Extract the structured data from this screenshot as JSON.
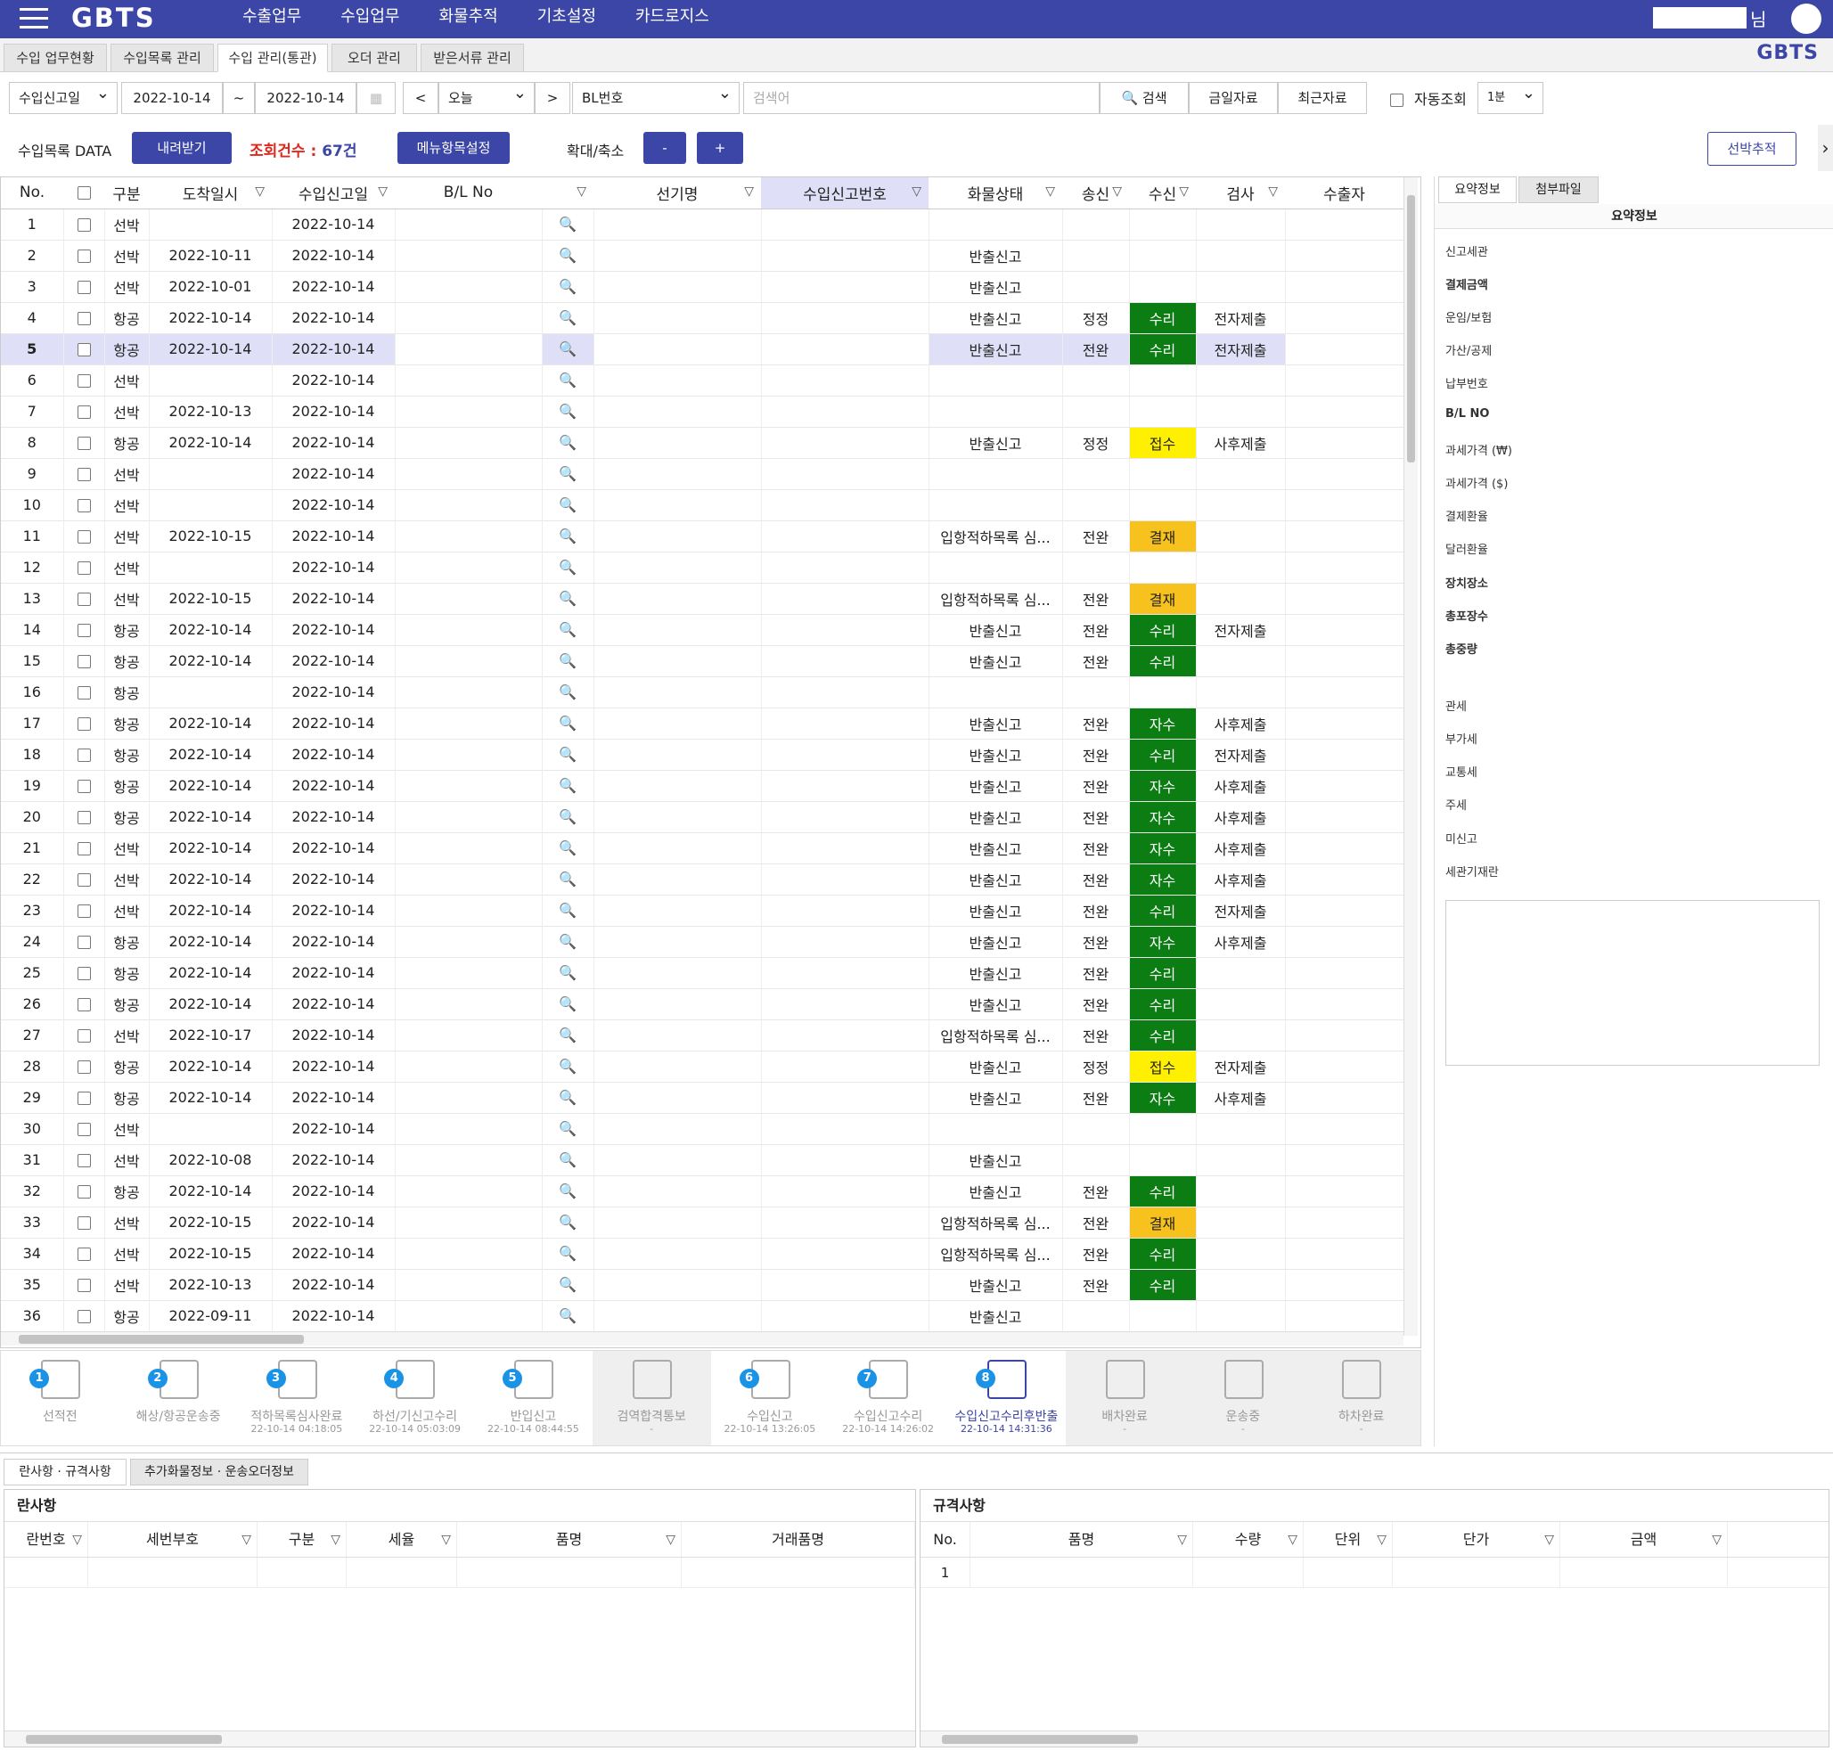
{
  "header": {
    "logo": "GBTS",
    "nav": [
      "수출업무",
      "수입업무",
      "화물추적",
      "기초설정",
      "카드로지스"
    ],
    "user_suffix": "님"
  },
  "tabs": [
    {
      "label": "수입 업무현황",
      "active": false
    },
    {
      "label": "수입목록 관리",
      "active": false
    },
    {
      "label": "수입 관리(통관)",
      "active": true
    },
    {
      "label": "오더 관리",
      "active": false
    },
    {
      "label": "받은서류 관리",
      "active": false
    }
  ],
  "brand_right": "GBTS",
  "filter": {
    "date_type": "수입신고일",
    "date_from": "2022-10-14",
    "tilde": "~",
    "date_to": "2022-10-14",
    "prev": "<",
    "period": "오늘",
    "next": ">",
    "search_type": "BL번호",
    "search_placeholder": "검색어",
    "search_button": "검색",
    "today_button": "금일자료",
    "recent_button": "최근자료",
    "auto_label": "자동조회",
    "auto_interval": "1분"
  },
  "actions": {
    "list_label": "수입목록 DATA",
    "download": "내려받기",
    "count_label": "조회건수 :",
    "count_value": "67건",
    "menu_setting": "메뉴항목설정",
    "zoom_label": "확대/축소",
    "zoom_out": "-",
    "zoom_in": "+",
    "vessel_track": "선박추적"
  },
  "grid": {
    "columns": [
      "No.",
      "",
      "구분",
      "도착일시",
      "수입신고일",
      "B/L No",
      "",
      "선기명",
      "수입신고번호",
      "화물상태",
      "송신",
      "수신",
      "검사",
      "수출자"
    ],
    "rows": [
      {
        "no": "1",
        "type": "선박",
        "arrive": "",
        "decl": "2022-10-14",
        "status": "",
        "send": "",
        "recv": "",
        "recvc": "",
        "insp": ""
      },
      {
        "no": "2",
        "type": "선박",
        "arrive": "2022-10-11",
        "decl": "2022-10-14",
        "status": "반출신고",
        "send": "",
        "recv": "",
        "recvc": "",
        "insp": ""
      },
      {
        "no": "3",
        "type": "선박",
        "arrive": "2022-10-01",
        "decl": "2022-10-14",
        "status": "반출신고",
        "send": "",
        "recv": "",
        "recvc": "",
        "insp": ""
      },
      {
        "no": "4",
        "type": "항공",
        "arrive": "2022-10-14",
        "decl": "2022-10-14",
        "status": "반출신고",
        "send": "정정",
        "recv": "수리",
        "recvc": "green",
        "insp": "전자제출"
      },
      {
        "no": "5",
        "type": "항공",
        "arrive": "2022-10-14",
        "decl": "2022-10-14",
        "status": "반출신고",
        "send": "전완",
        "recv": "수리",
        "recvc": "green",
        "insp": "전자제출",
        "selected": true
      },
      {
        "no": "6",
        "type": "선박",
        "arrive": "",
        "decl": "2022-10-14",
        "status": "",
        "send": "",
        "recv": "",
        "recvc": "",
        "insp": ""
      },
      {
        "no": "7",
        "type": "선박",
        "arrive": "2022-10-13",
        "decl": "2022-10-14",
        "status": "",
        "send": "",
        "recv": "",
        "recvc": "",
        "insp": ""
      },
      {
        "no": "8",
        "type": "항공",
        "arrive": "2022-10-14",
        "decl": "2022-10-14",
        "status": "반출신고",
        "send": "정정",
        "recv": "접수",
        "recvc": "yellow",
        "insp": "사후제출"
      },
      {
        "no": "9",
        "type": "선박",
        "arrive": "",
        "decl": "2022-10-14",
        "status": "",
        "send": "",
        "recv": "",
        "recvc": "",
        "insp": ""
      },
      {
        "no": "10",
        "type": "선박",
        "arrive": "",
        "decl": "2022-10-14",
        "status": "",
        "send": "",
        "recv": "",
        "recvc": "",
        "insp": ""
      },
      {
        "no": "11",
        "type": "선박",
        "arrive": "2022-10-15",
        "decl": "2022-10-14",
        "status": "입항적하목록 심...",
        "send": "전완",
        "recv": "결재",
        "recvc": "orange",
        "insp": ""
      },
      {
        "no": "12",
        "type": "선박",
        "arrive": "",
        "decl": "2022-10-14",
        "status": "",
        "send": "",
        "recv": "",
        "recvc": "",
        "insp": ""
      },
      {
        "no": "13",
        "type": "선박",
        "arrive": "2022-10-15",
        "decl": "2022-10-14",
        "status": "입항적하목록 심...",
        "send": "전완",
        "recv": "결재",
        "recvc": "orange",
        "insp": ""
      },
      {
        "no": "14",
        "type": "항공",
        "arrive": "2022-10-14",
        "decl": "2022-10-14",
        "status": "반출신고",
        "send": "전완",
        "recv": "수리",
        "recvc": "green",
        "insp": "전자제출"
      },
      {
        "no": "15",
        "type": "항공",
        "arrive": "2022-10-14",
        "decl": "2022-10-14",
        "status": "반출신고",
        "send": "전완",
        "recv": "수리",
        "recvc": "green",
        "insp": ""
      },
      {
        "no": "16",
        "type": "항공",
        "arrive": "",
        "decl": "2022-10-14",
        "status": "",
        "send": "",
        "recv": "",
        "recvc": "",
        "insp": ""
      },
      {
        "no": "17",
        "type": "항공",
        "arrive": "2022-10-14",
        "decl": "2022-10-14",
        "status": "반출신고",
        "send": "전완",
        "recv": "자수",
        "recvc": "green",
        "insp": "사후제출"
      },
      {
        "no": "18",
        "type": "항공",
        "arrive": "2022-10-14",
        "decl": "2022-10-14",
        "status": "반출신고",
        "send": "전완",
        "recv": "수리",
        "recvc": "green",
        "insp": "전자제출"
      },
      {
        "no": "19",
        "type": "항공",
        "arrive": "2022-10-14",
        "decl": "2022-10-14",
        "status": "반출신고",
        "send": "전완",
        "recv": "자수",
        "recvc": "green",
        "insp": "사후제출"
      },
      {
        "no": "20",
        "type": "항공",
        "arrive": "2022-10-14",
        "decl": "2022-10-14",
        "status": "반출신고",
        "send": "전완",
        "recv": "자수",
        "recvc": "green",
        "insp": "사후제출"
      },
      {
        "no": "21",
        "type": "선박",
        "arrive": "2022-10-14",
        "decl": "2022-10-14",
        "status": "반출신고",
        "send": "전완",
        "recv": "자수",
        "recvc": "green",
        "insp": "사후제출"
      },
      {
        "no": "22",
        "type": "선박",
        "arrive": "2022-10-14",
        "decl": "2022-10-14",
        "status": "반출신고",
        "send": "전완",
        "recv": "자수",
        "recvc": "green",
        "insp": "사후제출"
      },
      {
        "no": "23",
        "type": "선박",
        "arrive": "2022-10-14",
        "decl": "2022-10-14",
        "status": "반출신고",
        "send": "전완",
        "recv": "수리",
        "recvc": "green",
        "insp": "전자제출"
      },
      {
        "no": "24",
        "type": "항공",
        "arrive": "2022-10-14",
        "decl": "2022-10-14",
        "status": "반출신고",
        "send": "전완",
        "recv": "자수",
        "recvc": "green",
        "insp": "사후제출"
      },
      {
        "no": "25",
        "type": "항공",
        "arrive": "2022-10-14",
        "decl": "2022-10-14",
        "status": "반출신고",
        "send": "전완",
        "recv": "수리",
        "recvc": "green",
        "insp": ""
      },
      {
        "no": "26",
        "type": "항공",
        "arrive": "2022-10-14",
        "decl": "2022-10-14",
        "status": "반출신고",
        "send": "전완",
        "recv": "수리",
        "recvc": "green",
        "insp": ""
      },
      {
        "no": "27",
        "type": "선박",
        "arrive": "2022-10-17",
        "decl": "2022-10-14",
        "status": "입항적하목록 심...",
        "send": "전완",
        "recv": "수리",
        "recvc": "green",
        "insp": ""
      },
      {
        "no": "28",
        "type": "항공",
        "arrive": "2022-10-14",
        "decl": "2022-10-14",
        "status": "반출신고",
        "send": "정정",
        "recv": "접수",
        "recvc": "yellow",
        "insp": "전자제출"
      },
      {
        "no": "29",
        "type": "항공",
        "arrive": "2022-10-14",
        "decl": "2022-10-14",
        "status": "반출신고",
        "send": "전완",
        "recv": "자수",
        "recvc": "green",
        "insp": "사후제출"
      },
      {
        "no": "30",
        "type": "선박",
        "arrive": "",
        "decl": "2022-10-14",
        "status": "",
        "send": "",
        "recv": "",
        "recvc": "",
        "insp": ""
      },
      {
        "no": "31",
        "type": "선박",
        "arrive": "2022-10-08",
        "decl": "2022-10-14",
        "status": "반출신고",
        "send": "",
        "recv": "",
        "recvc": "",
        "insp": ""
      },
      {
        "no": "32",
        "type": "항공",
        "arrive": "2022-10-14",
        "decl": "2022-10-14",
        "status": "반출신고",
        "send": "전완",
        "recv": "수리",
        "recvc": "green",
        "insp": ""
      },
      {
        "no": "33",
        "type": "선박",
        "arrive": "2022-10-15",
        "decl": "2022-10-14",
        "status": "입항적하목록 심...",
        "send": "전완",
        "recv": "결재",
        "recvc": "orange",
        "insp": ""
      },
      {
        "no": "34",
        "type": "선박",
        "arrive": "2022-10-15",
        "decl": "2022-10-14",
        "status": "입항적하목록 심...",
        "send": "전완",
        "recv": "수리",
        "recvc": "green",
        "insp": ""
      },
      {
        "no": "35",
        "type": "선박",
        "arrive": "2022-10-13",
        "decl": "2022-10-14",
        "status": "반출신고",
        "send": "전완",
        "recv": "수리",
        "recvc": "green",
        "insp": ""
      },
      {
        "no": "36",
        "type": "항공",
        "arrive": "2022-09-11",
        "decl": "2022-10-14",
        "status": "반출신고",
        "send": "",
        "recv": "",
        "recvc": "",
        "insp": ""
      }
    ]
  },
  "steps": [
    {
      "num": "1",
      "name": "선적전",
      "time": "",
      "icon": "warehouse-icon",
      "dim": false,
      "current": false
    },
    {
      "num": "2",
      "name": "해상/항공운송중",
      "time": "",
      "icon": "ship-icon",
      "dim": false,
      "current": false
    },
    {
      "num": "3",
      "name": "적하목록심사완료",
      "time": "22-10-14 04:18:05",
      "icon": "document-check-icon",
      "dim": false,
      "current": false
    },
    {
      "num": "4",
      "name": "하선/기신고수리",
      "time": "22-10-14 05:03:09",
      "icon": "unload-icon",
      "dim": false,
      "current": false
    },
    {
      "num": "5",
      "name": "반입신고",
      "time": "22-10-14 08:44:55",
      "icon": "forklift-icon",
      "dim": false,
      "current": false
    },
    {
      "num": "",
      "name": "검역합격통보",
      "time": "-",
      "icon": "shield-check-icon",
      "dim": true,
      "current": false
    },
    {
      "num": "6",
      "name": "수입신고",
      "time": "22-10-14 13:26:05",
      "icon": "declaration-icon",
      "dim": false,
      "current": false
    },
    {
      "num": "7",
      "name": "수입신고수리",
      "time": "22-10-14 14:26:02",
      "icon": "declaration-accept-icon",
      "dim": false,
      "current": false
    },
    {
      "num": "8",
      "name": "수입신고수리후반출",
      "time": "22-10-14 14:31:36",
      "icon": "forklift-out-icon",
      "dim": false,
      "current": true
    },
    {
      "num": "",
      "name": "배차완료",
      "time": "-",
      "icon": "dispatch-icon",
      "dim": true,
      "current": false
    },
    {
      "num": "",
      "name": "운송중",
      "time": "-",
      "icon": "truck-clock-icon",
      "dim": true,
      "current": false
    },
    {
      "num": "",
      "name": "하차완료",
      "time": "-",
      "icon": "unload-check-icon",
      "dim": true,
      "current": false
    }
  ],
  "side": {
    "tabs": [
      "요약정보",
      "첨부파일"
    ],
    "title": "요약정보",
    "fields": [
      {
        "label": "신고세관",
        "bold": false
      },
      {
        "label": "결제금액",
        "bold": true
      },
      {
        "label": "운임/보험",
        "bold": false
      },
      {
        "label": "가산/공제",
        "bold": false
      },
      {
        "label": "납부번호",
        "bold": false
      },
      {
        "label": "B/L NO",
        "bold": true
      },
      {
        "label": "과세가격 (₩)",
        "bold": false
      },
      {
        "label": "과세가격 ($)",
        "bold": false
      },
      {
        "label": "결제환율",
        "bold": false
      },
      {
        "label": "달러환율",
        "bold": false
      },
      {
        "label": "장치장소",
        "bold": true
      },
      {
        "label": "총포장수",
        "bold": true
      },
      {
        "label": "총중량",
        "bold": true
      },
      {
        "label": "관세",
        "bold": false
      },
      {
        "label": "부가세",
        "bold": false
      },
      {
        "label": "교통세",
        "bold": false
      },
      {
        "label": "주세",
        "bold": false
      },
      {
        "label": "미신고",
        "bold": false
      },
      {
        "label": "세관기재란",
        "bold": false
      }
    ]
  },
  "bottom": {
    "tabs": [
      "란사항 · 규격사항",
      "추가화물정보 · 운송오더정보"
    ],
    "left_title": "란사항",
    "left_cols": [
      "란번호",
      "세번부호",
      "구분",
      "세율",
      "품명",
      "거래품명"
    ],
    "right_title": "규격사항",
    "right_cols": [
      "No.",
      "품명",
      "수량",
      "단위",
      "단가",
      "금액"
    ],
    "right_row_no": "1"
  }
}
